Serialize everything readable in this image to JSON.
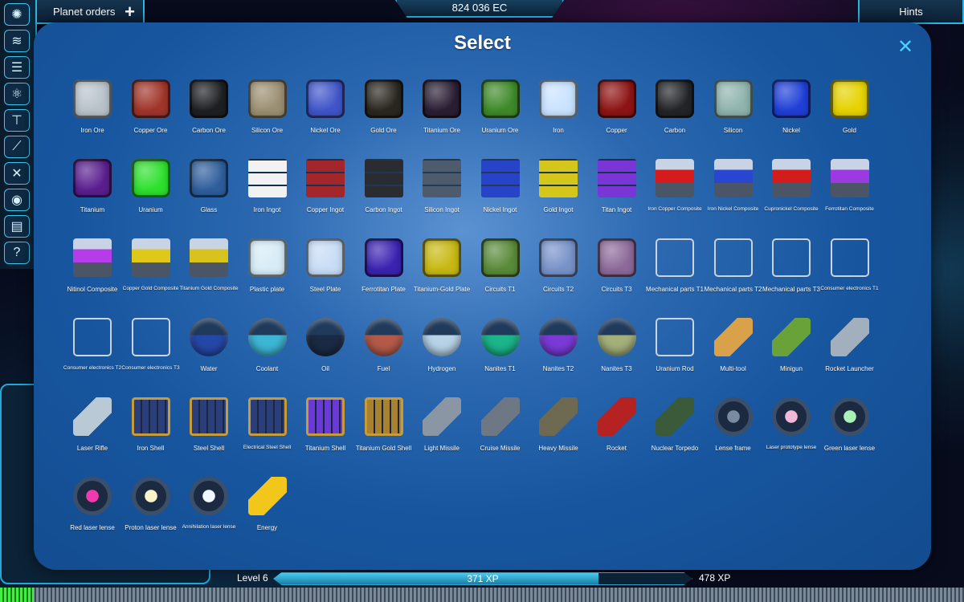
{
  "topbar": {
    "planet_orders_label": "Planet orders",
    "planet_orders_icon": "plus-icon",
    "credits": "824 036 EC",
    "hints_label": "Hints"
  },
  "sidebar": {
    "items": [
      {
        "icon": "planet-icon"
      },
      {
        "icon": "layers-icon"
      },
      {
        "icon": "list-icon"
      },
      {
        "icon": "atom-icon"
      },
      {
        "icon": "tree-icon"
      },
      {
        "icon": "ship-icon"
      },
      {
        "icon": "tools-icon"
      },
      {
        "icon": "eye-icon"
      },
      {
        "icon": "storage-icon"
      },
      {
        "icon": "help-icon"
      }
    ]
  },
  "modal": {
    "title": "Select",
    "close_icon": "close-icon",
    "items": [
      {
        "label": "Iron Ore",
        "color": "#b9c2ca"
      },
      {
        "label": "Copper Ore",
        "color": "#a0352a"
      },
      {
        "label": "Carbon Ore",
        "color": "#1d1f22"
      },
      {
        "label": "Silicon Ore",
        "color": "#9c8f72"
      },
      {
        "label": "Nickel Ore",
        "color": "#3f55c8"
      },
      {
        "label": "Gold Ore",
        "color": "#2a2620"
      },
      {
        "label": "Titanium Ore",
        "color": "#2a1e33"
      },
      {
        "label": "Uranium Ore",
        "color": "#3f8a2a"
      },
      {
        "label": "Iron",
        "color": "#c9e3ff"
      },
      {
        "label": "Copper",
        "color": "#8e1414"
      },
      {
        "label": "Carbon",
        "color": "#222427"
      },
      {
        "label": "Silicon",
        "color": "#8fb3ad"
      },
      {
        "label": "Nickel",
        "color": "#1f3fd6"
      },
      {
        "label": "Gold",
        "color": "#e6d200"
      },
      {
        "label": "Titanium",
        "color": "#5a1f8f"
      },
      {
        "label": "Uranium",
        "color": "#2ee02e"
      },
      {
        "label": "Glass",
        "color": "#2f5e9c"
      },
      {
        "label": "Iron Ingot",
        "color": "#f2f2f2"
      },
      {
        "label": "Copper Ingot",
        "color": "#a3262a"
      },
      {
        "label": "Carbon Ingot",
        "color": "#2a2c30"
      },
      {
        "label": "Silicon Ingot",
        "color": "#4d5b6c"
      },
      {
        "label": "Nickel Ingot",
        "color": "#2743c7"
      },
      {
        "label": "Gold Ingot",
        "color": "#d4c61a"
      },
      {
        "label": "Titan Ingot",
        "color": "#7a35d6"
      },
      {
        "label": "Iron Copper Composite",
        "color": "#d51b1b"
      },
      {
        "label": "Iron Nickel Composite",
        "color": "#2a45cf"
      },
      {
        "label": "Cupronickel Composite",
        "color": "#d31c1c"
      },
      {
        "label": "Ferrotitan Composite",
        "color": "#9a3ae0"
      },
      {
        "label": "Nitinol Composite",
        "color": "#b53ce8"
      },
      {
        "label": "Copper Gold Composite",
        "color": "#e0c81a"
      },
      {
        "label": "Titanium Gold Composite",
        "color": "#d7c21e"
      },
      {
        "label": "Plastic plate",
        "color": "#d6ecf7"
      },
      {
        "label": "Steel Plate",
        "color": "#c7dcf5"
      },
      {
        "label": "Ferrotitan Plate",
        "color": "#3b23b0"
      },
      {
        "label": "Titanium-Gold Plate",
        "color": "#c7b912"
      },
      {
        "label": "Circuits T1",
        "color": "#5a8a3a"
      },
      {
        "label": "Circuits T2",
        "color": "#7893c9"
      },
      {
        "label": "Circuits T3",
        "color": "#8d6a99"
      },
      {
        "label": "Mechanical parts T1",
        "color": "#dfe5ea"
      },
      {
        "label": "Mechanical parts T2",
        "color": "#dfe5ea"
      },
      {
        "label": "Mechanical parts T3",
        "color": "#dfe5ea"
      },
      {
        "label": "Consumer electronics T1",
        "color": "#dfe5ea"
      },
      {
        "label": "Consumer electronics T2",
        "color": "#dfe5ea"
      },
      {
        "label": "Consumer electronics T3",
        "color": "#dfe5ea"
      },
      {
        "label": "Water",
        "color": "#2548a8"
      },
      {
        "label": "Coolant",
        "color": "#3db6d6"
      },
      {
        "label": "Oil",
        "color": "#1b2a44"
      },
      {
        "label": "Fuel",
        "color": "#b55a4a"
      },
      {
        "label": "Hydrogen",
        "color": "#b8d3e8"
      },
      {
        "label": "Nanites T1",
        "color": "#1bb58a"
      },
      {
        "label": "Nanites T2",
        "color": "#7a3ad6"
      },
      {
        "label": "Nanites T3",
        "color": "#a3b07a"
      },
      {
        "label": "Uranium Rod",
        "color": "#8d9aa6"
      },
      {
        "label": "Multi-tool",
        "color": "#d9a24a"
      },
      {
        "label": "Minigun",
        "color": "#6aa23a"
      },
      {
        "label": "Rocket Launcher",
        "color": "#a2b0bd"
      },
      {
        "label": "Laser Rifle",
        "color": "#b9c9d6"
      },
      {
        "label": "Iron Shell",
        "color": "#2a3f7a"
      },
      {
        "label": "Steel Shell",
        "color": "#2a3f7a"
      },
      {
        "label": "Electrical Steel Shell",
        "color": "#2a3f7a"
      },
      {
        "label": "Titanium Shell",
        "color": "#6a3ad6"
      },
      {
        "label": "Titanium Gold Shell",
        "color": "#a8822e"
      },
      {
        "label": "Light Missile",
        "color": "#8a96a4"
      },
      {
        "label": "Cruise Missile",
        "color": "#6e7884"
      },
      {
        "label": "Heavy Missile",
        "color": "#6e6a52"
      },
      {
        "label": "Rocket",
        "color": "#b52222"
      },
      {
        "label": "Nuclear Torpedo",
        "color": "#3a5a3a"
      },
      {
        "label": "Lense frame",
        "color": "#7a8aa0"
      },
      {
        "label": "Laser prototype lense",
        "color": "#f2b8d9"
      },
      {
        "label": "Green laser lense",
        "color": "#a8f2b8"
      },
      {
        "label": "Red laser lense",
        "color": "#f23ab0"
      },
      {
        "label": "Proton laser lense",
        "color": "#f7f2c8"
      },
      {
        "label": "Annihilation laser lense",
        "color": "#f2f7ff"
      },
      {
        "label": "Energy",
        "color": "#f2c61a"
      }
    ]
  },
  "progress": {
    "level": "Level 6",
    "current_xp": "371 XP",
    "next_xp": "478 XP",
    "fill_fraction": 0.776
  }
}
